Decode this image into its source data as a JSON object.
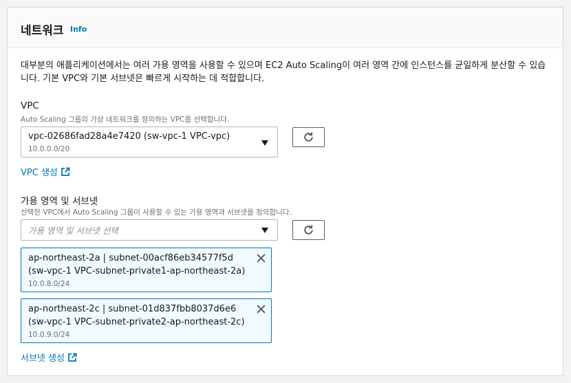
{
  "header": {
    "title": "네트워크",
    "info_link": "Info"
  },
  "description": "대부분의 애플리케이션에서는 여러 가용 영역을 사용할 수 있으며 EC2 Auto Scaling이 여러 영역 간에 인스턴스를 균일하게 분산할 수 있습니다. 기본 VPC와 기본 서브넷은 빠르게 시작하는 데 적합합니다.",
  "vpc": {
    "label": "VPC",
    "hint": "Auto Scaling 그룹의 가상 네트워크를 정의하는 VPC를 선택합니다.",
    "selected_value": "vpc-02686fad28a4e7420 (sw-vpc-1 VPC-vpc)",
    "selected_cidr": "10.0.0.0/20",
    "create_link": "VPC 생성"
  },
  "subnets": {
    "label": "가용 영역 및 서브넷",
    "hint": "선택한 VPC에서 Auto Scaling 그룹이 사용할 수 있는 가용 영역과 서브넷을 정의합니다.",
    "placeholder": "가용 영역 및 서브넷 선택",
    "selected": [
      {
        "line1": "ap-northeast-2a | subnet-00acf86eb34577f5d",
        "line2": "(sw-vpc-1 VPC-subnet-private1-ap-northeast-2a)",
        "cidr": "10.0.8.0/24"
      },
      {
        "line1": "ap-northeast-2c | subnet-01d837fbb8037d6e6",
        "line2": "(sw-vpc-1 VPC-subnet-private2-ap-northeast-2c)",
        "cidr": "10.0.9.0/24"
      }
    ],
    "create_link": "서브넷 생성"
  },
  "icons": {
    "refresh": "refresh-icon",
    "external": "external-link-icon",
    "close": "close-icon",
    "caret": "caret-down-icon"
  },
  "colors": {
    "link": "#0073bb",
    "token_bg": "#f1faff",
    "token_border": "#0073bb"
  }
}
